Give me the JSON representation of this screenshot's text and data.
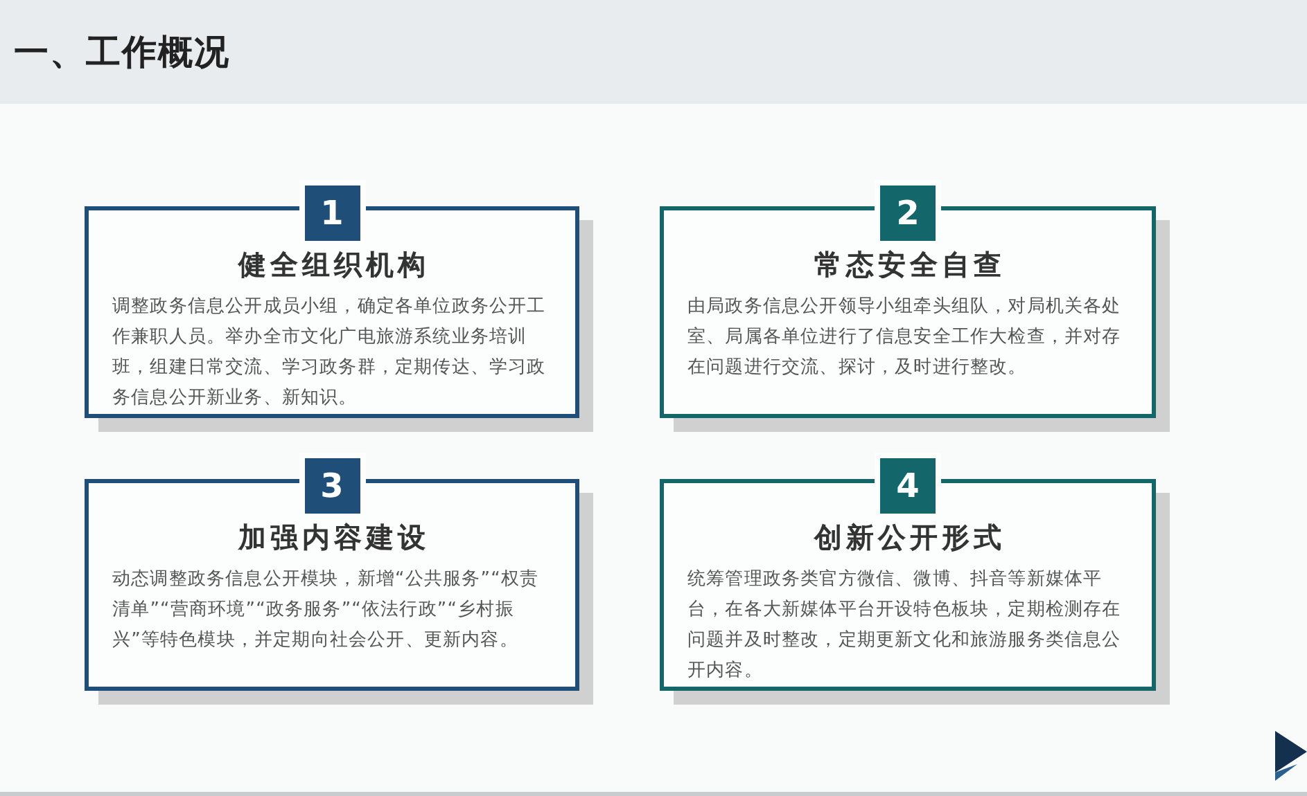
{
  "header": {
    "title": "一、工作概况"
  },
  "cards": [
    {
      "number": "1",
      "title": "健全组织机构",
      "text": "调整政务信息公开成员小组，确定各单位政务公开工作兼职人员。举办全市文化广电旅游系统业务培训班，组建日常交流、学习政务群，定期传达、学习政务信息公开新业务、新知识。",
      "color": "#1f4e79"
    },
    {
      "number": "2",
      "title": "常态安全自查",
      "text": "由局政务信息公开领导小组牵头组队，对局机关各处室、局属各单位进行了信息安全工作大检查，并对存在问题进行交流、探讨，及时进行整改。",
      "color": "#13676a"
    },
    {
      "number": "3",
      "title": "加强内容建设",
      "text": "动态调整政务信息公开模块，新增“公共服务”“权责清单”“营商环境”“政务服务”“依法行政”“乡村振兴”等特色模块，并定期向社会公开、更新内容。",
      "color": "#1f4e79"
    },
    {
      "number": "4",
      "title": "创新公开形式",
      "text": "统筹管理政务类官方微信、微博、抖音等新媒体平台，在各大新媒体平台开设特色板块，定期检测存在问题并及时整改，定期更新文化和旅游服务类信息公开内容。",
      "color": "#13676a"
    }
  ]
}
